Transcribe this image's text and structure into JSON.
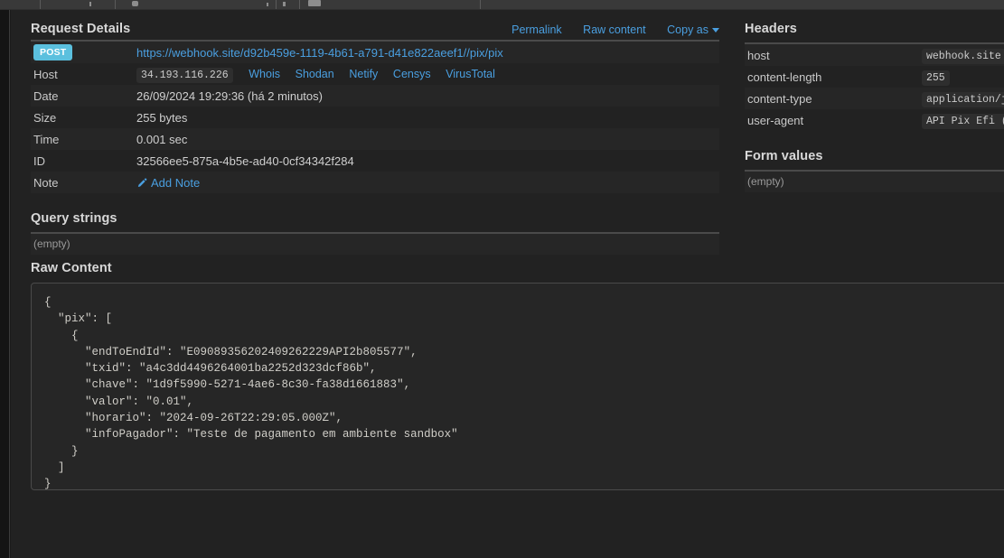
{
  "window": {
    "background_color": "#1c1c1c",
    "panel_color": "#222222"
  },
  "request_details": {
    "title": "Request Details",
    "actions": [
      {
        "label": "Permalink",
        "name": "permalink-link"
      },
      {
        "label": "Raw content",
        "name": "raw-content-link"
      },
      {
        "label": "Copy as",
        "name": "copy-as-dropdown"
      }
    ],
    "method": "POST",
    "url": "https://webhook.site/d92b459e-1119-4b61-a791-d41e822aeef1//pix/pix",
    "rows": [
      {
        "key": "Host",
        "value": "34.193.116.226"
      },
      {
        "key": "Date",
        "value": "26/09/2024 19:29:36 (há 2 minutos)"
      },
      {
        "key": "Size",
        "value": "255 bytes"
      },
      {
        "key": "Time",
        "value": "0.001 sec"
      },
      {
        "key": "ID",
        "value": "32566ee5-875a-4b5e-ad40-0cf34342f284"
      },
      {
        "key": "Note",
        "value": "Add Note"
      }
    ],
    "host_lookup_links": [
      "Whois",
      "Shodan",
      "Netify",
      "Censys",
      "VirusTotal"
    ]
  },
  "query_strings": {
    "title": "Query strings",
    "empty_text": "(empty)"
  },
  "form_values": {
    "title": "Form values",
    "empty_text": "(empty)"
  },
  "headers": {
    "title": "Headers",
    "rows": [
      {
        "key": "host",
        "value": "webhook.site"
      },
      {
        "key": "content-length",
        "value": "255"
      },
      {
        "key": "content-type",
        "value": "application/js"
      },
      {
        "key": "user-agent",
        "value": "API Pix Efi (h"
      }
    ]
  },
  "raw_content": {
    "title": "Raw Content",
    "body": "{\n  \"pix\": [\n    {\n      \"endToEndId\": \"E09089356202409262229API2b805577\",\n      \"txid\": \"a4c3dd4496264001ba2252d323dcf86b\",\n      \"chave\": \"1d9f5990-5271-4ae6-8c30-fa38d1661883\",\n      \"valor\": \"0.01\",\n      \"horario\": \"2024-09-26T22:29:05.000Z\",\n      \"infoPagador\": \"Teste de pagamento em ambiente sandbox\"\n    }\n  ]\n}"
  },
  "colors": {
    "accent_link": "#4a9fe0",
    "method_badge": "#5bc0de",
    "panel": "#222222",
    "row_stripe": "#262626"
  }
}
